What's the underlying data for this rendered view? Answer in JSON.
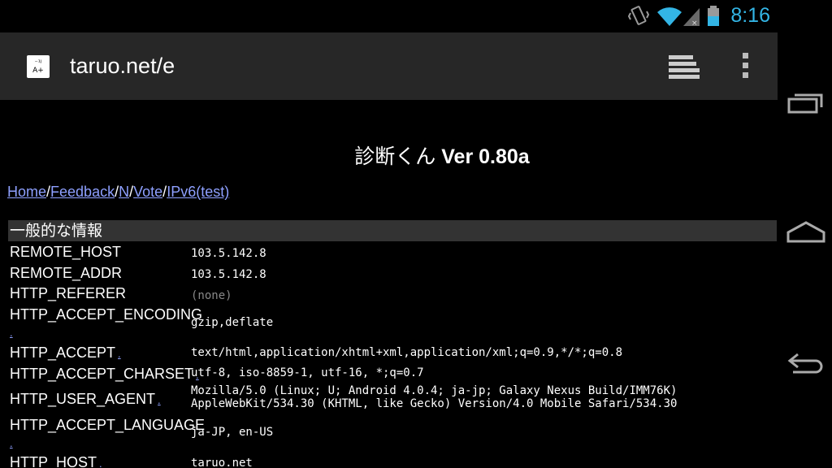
{
  "status_bar": {
    "time": "8:16",
    "icons": [
      "vibrate-icon",
      "wifi-icon",
      "signal-icon",
      "battery-icon"
    ],
    "accent_color": "#33b5e5"
  },
  "browser": {
    "url": "taruo.net/e",
    "favicon_text": "A+",
    "icons": [
      "tabs-icon",
      "overflow-menu-icon"
    ]
  },
  "nav_bar": {
    "icons": [
      "recent-apps-icon",
      "home-icon",
      "back-icon"
    ]
  },
  "page": {
    "title_jp": "診断くん",
    "title_ver": " Ver 0.80a",
    "links": [
      "Home",
      "Feedback",
      "N",
      "Vote",
      "IPv6(test)"
    ],
    "link_separator": "/",
    "section_header": "一般的な情報",
    "note_mark": ".",
    "rows": [
      {
        "key": "REMOTE_HOST",
        "value": "103.5.142.8"
      },
      {
        "key": "REMOTE_ADDR",
        "value": "103.5.142.8"
      },
      {
        "key": "HTTP_REFERER",
        "value": "(none)"
      },
      {
        "key": "HTTP_ACCEPT_ENCODING",
        "value": "gzip,deflate"
      },
      {
        "key": "HTTP_ACCEPT",
        "value": "text/html,application/xhtml+xml,application/xml;q=0.9,*/*;q=0.8"
      },
      {
        "key": "HTTP_ACCEPT_CHARSET",
        "value": "utf-8, iso-8859-1, utf-16, *;q=0.7"
      },
      {
        "key": "HTTP_USER_AGENT",
        "value": "Mozilla/5.0 (Linux; U; Android 4.0.4; ja-jp; Galaxy Nexus Build/IMM76K)\nAppleWebKit/534.30 (KHTML, like Gecko) Version/4.0 Mobile Safari/534.30"
      },
      {
        "key": "HTTP_ACCEPT_LANGUAGE",
        "value": "ja-JP, en-US"
      },
      {
        "key": "HTTP_HOST",
        "value": "taruo.net"
      }
    ],
    "link_color": "#8ea0ff",
    "section_color": "#333333"
  }
}
